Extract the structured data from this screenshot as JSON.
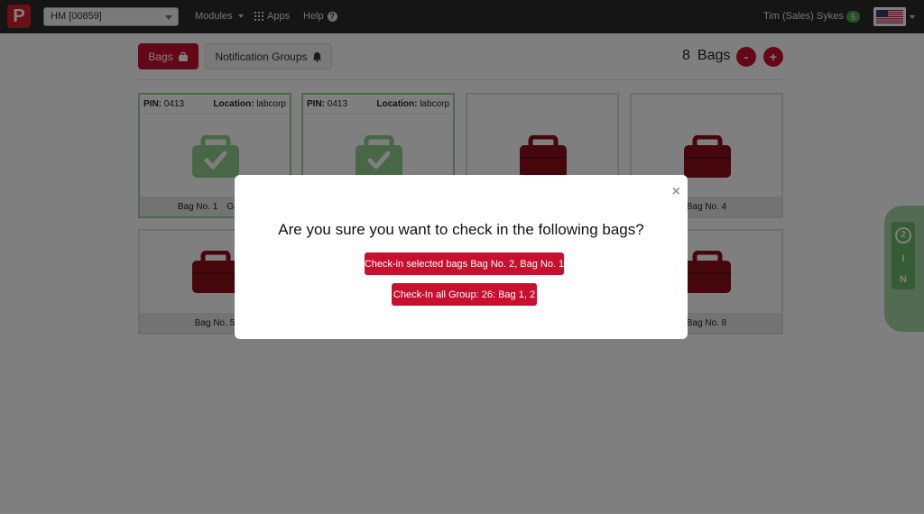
{
  "colors": {
    "brand_red": "#c8102e",
    "navbar": "#2a2a2a",
    "checked_green": "#8fcf8f",
    "bag_red": "#8b0d18"
  },
  "navbar": {
    "logo_letter": "P",
    "org_selector": "HM [00859]",
    "modules_label": "Modules",
    "apps_label": "Apps",
    "help_label": "Help",
    "user_name": "Tim (Sales) Sykes",
    "notification_count": "5",
    "language_flag_icon": "us-flag-icon"
  },
  "toolbar": {
    "bags_tab_label": "Bags",
    "notification_groups_label": "Notification Groups",
    "bag_count": "8",
    "bag_count_label": "Bags",
    "remove_label": "-",
    "add_label": "+"
  },
  "bags": [
    {
      "pin_label": "PIN:",
      "pin": "0413",
      "location_label": "Location:",
      "location": "labcorp",
      "name": "Bag No. 1",
      "group": "Group",
      "checked": true
    },
    {
      "pin_label": "PIN:",
      "pin": "0413",
      "location_label": "Location:",
      "location": "labcorp",
      "name": "",
      "group": "",
      "checked": true
    },
    {
      "name": "",
      "checked": false
    },
    {
      "name": "Bag No. 4",
      "checked": false
    },
    {
      "name": "Bag No. 5",
      "checked": false
    },
    {
      "name": "",
      "checked": false
    },
    {
      "name": "",
      "checked": false
    },
    {
      "name": "Bag No. 8",
      "checked": false
    }
  ],
  "side_tab": {
    "count": "2",
    "letters": [
      "I",
      "N"
    ]
  },
  "modal": {
    "close_symbol": "×",
    "title": "Are you sure you want to check in the following bags?",
    "check_in_selected_label": "Check-in selected bags Bag No. 2, Bag No. 1",
    "check_in_group_label": "Check-In all Group: 26: Bag 1, 2"
  }
}
